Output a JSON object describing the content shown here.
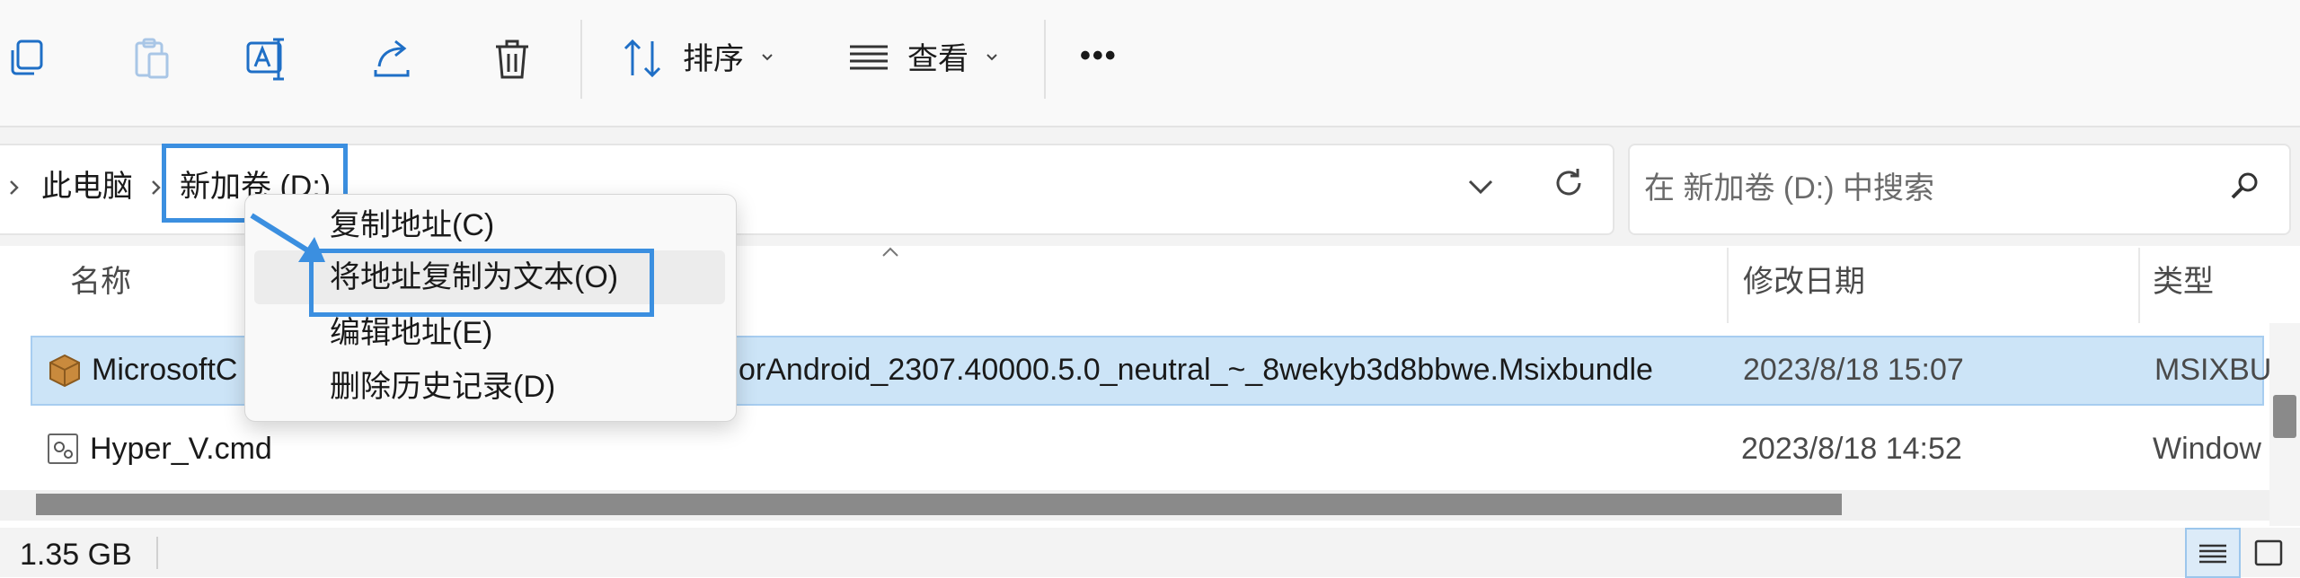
{
  "toolbar": {
    "sort_label": "排序",
    "view_label": "查看",
    "more_label": "•••"
  },
  "address": {
    "crumb_1": "此电脑",
    "crumb_2": "新加卷 (D:)",
    "search_placeholder": "在 新加卷 (D:) 中搜索"
  },
  "context_menu": {
    "items": [
      "复制地址(C)",
      "将地址复制为文本(O)",
      "编辑地址(E)",
      "删除历史记录(D)"
    ]
  },
  "list": {
    "columns": [
      "名称",
      "修改日期",
      "类型"
    ],
    "rows": [
      {
        "name_left": "MicrosoftC",
        "name_right": "orAndroid_2307.40000.5.0_neutral_~_8wekyb3d8bbwe.Msixbundle",
        "date": "2023/8/18 15:07",
        "type": "MSIXBU"
      },
      {
        "name_left": "Hyper_V.cmd",
        "name_right": "",
        "date": "2023/8/18 14:52",
        "type": "Window"
      }
    ]
  },
  "status": {
    "size": "1.35 GB"
  },
  "colors": {
    "highlight": "#3b8fe0",
    "selected_row": "#cce4f7"
  }
}
